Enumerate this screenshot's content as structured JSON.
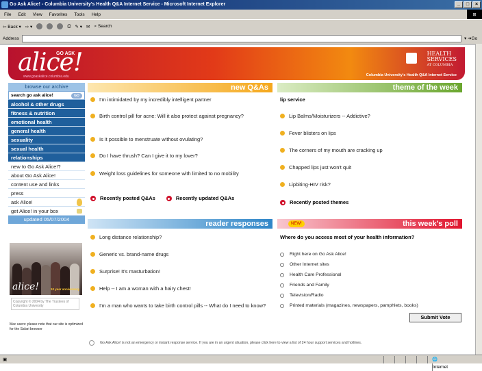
{
  "window": {
    "title": "Go Ask Alice! - Columbia University's Health Q&A Internet Service - Microsoft Internet Explorer"
  },
  "menu": [
    "File",
    "Edit",
    "View",
    "Favorites",
    "Tools",
    "Help"
  ],
  "toolbar": {
    "back": "Back",
    "search": "Search"
  },
  "address": {
    "label": "Address",
    "go": "Go"
  },
  "banner": {
    "logo": "alice!",
    "goask": "GO ASK",
    "url": "www.goaskalice.columbia.edu",
    "hs1": "HEALTH",
    "hs2": "SERVICES",
    "hs3": "AT COLUMBIA",
    "sub": "Columbia University's Health Q&A Internet Service"
  },
  "nav": {
    "browse": "browse our archive",
    "search": "search go ask alice!",
    "search_go": "GO",
    "categories": [
      "alcohol & other drugs",
      "fitness & nutrition",
      "emotional health",
      "general health",
      "sexuality",
      "sexual health",
      "relationships"
    ],
    "links": [
      "new to Go Ask Alice!?",
      "about Go Ask Alice!",
      "content use and links",
      "press",
      "ask Alice!",
      "get Alice! in your box"
    ],
    "updated": "updated 05/07/2004"
  },
  "photo": {
    "label": "alice!",
    "anniv": "10 year anniversary"
  },
  "copyright": "Copyright © 2004 by The Trustees of Columbia University",
  "mac_note": "Mac users: please note that our site is optimized for the Safari browser",
  "new_qa": {
    "title": "new Q&As",
    "items": [
      "I'm intimidated by my incredibly intelligent partner",
      "Birth control pill for acne: Will it also protect against pregnancy?",
      "Is it possible to menstruate without ovulating?",
      "Do I have thrush? Can I give it to my lover?",
      "Weight loss guidelines for someone with limited to no mobility"
    ],
    "recent_posted": "Recently posted Q&As",
    "recent_updated": "Recently updated Q&As"
  },
  "theme": {
    "title": "theme of the week",
    "heading": "lip service",
    "items": [
      "Lip Balms/Moisturizers -- Addictive?",
      "Fever blisters on lips",
      "The corners of my mouth are cracking up",
      "Chapped lips just won't quit",
      "Lipbiting-HIV risk?"
    ],
    "recent": "Recently posted themes"
  },
  "reader": {
    "title": "reader responses",
    "items": [
      "Long distance relationship?",
      "Generic vs. brand-name drugs",
      "Surprise! It's masturbation!",
      "Help -- I am a woman with a hairy chest!",
      "I'm a man who wants to take birth control pills -- What do I need to know?"
    ]
  },
  "poll": {
    "title": "this week's poll",
    "badge": "NEW!",
    "question": "Where do you access most of your health information?",
    "options": [
      "Right here on Go Ask Alice!",
      "Other Internet sites",
      "Health Care Professional",
      "Friends and Family",
      "Television/Radio",
      "Printed materials (magazines, newspapers, pamphlets, books)"
    ],
    "submit": "Submit Vote"
  },
  "disclaimer": "Go Ask Alice! is not an emergency or instant response service. If you are in an urgent situation, please click here to view a list of 24 hour support services and hotlines.",
  "status": {
    "zone": "Internet"
  },
  "colors": {
    "qa": "#f5a81c",
    "theme": "#6aa62e",
    "reader": "#2f86c8",
    "poll": "#e0142e"
  }
}
